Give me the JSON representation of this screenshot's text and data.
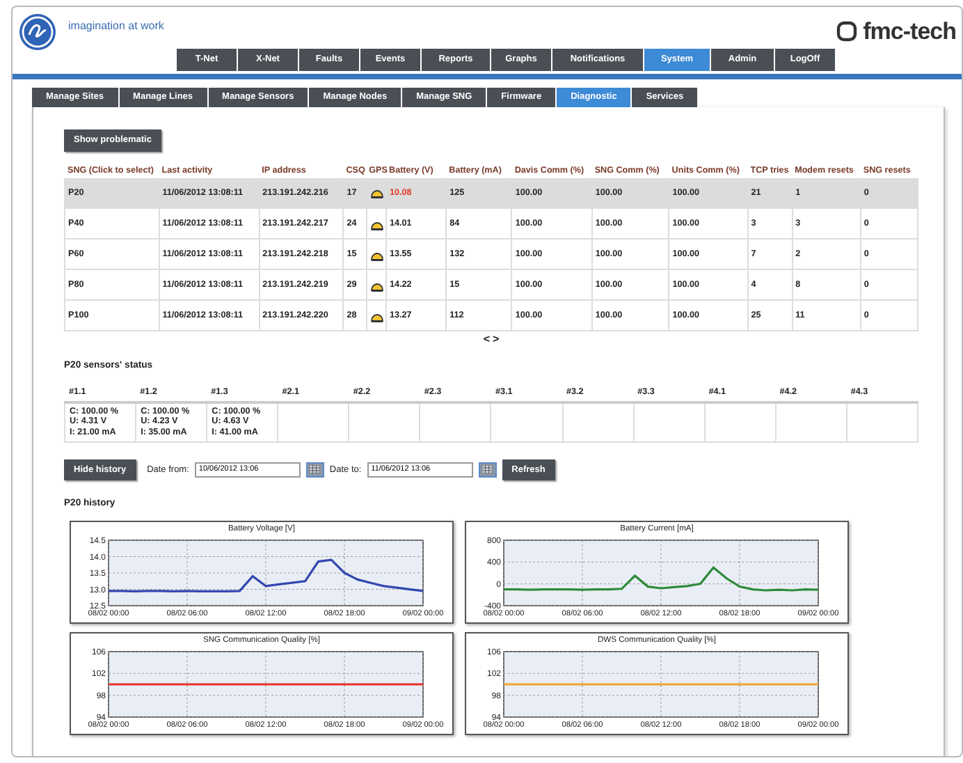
{
  "header": {
    "tagline": "imagination at work",
    "brand": "fmc-tech"
  },
  "main_tabs": [
    {
      "label": "T-Net",
      "selected": false
    },
    {
      "label": "X-Net",
      "selected": false
    },
    {
      "label": "Faults",
      "selected": false
    },
    {
      "label": "Events",
      "selected": false
    },
    {
      "label": "Reports",
      "selected": false
    },
    {
      "label": "Graphs",
      "selected": false
    },
    {
      "label": "Notifications",
      "selected": false
    },
    {
      "label": "System",
      "selected": true
    },
    {
      "label": "Admin",
      "selected": false
    },
    {
      "label": "LogOff",
      "selected": false
    }
  ],
  "sub_tabs": [
    {
      "label": "Manage Sites",
      "selected": false
    },
    {
      "label": "Manage Lines",
      "selected": false
    },
    {
      "label": "Manage Sensors",
      "selected": false
    },
    {
      "label": "Manage Nodes",
      "selected": false
    },
    {
      "label": "Manage SNG",
      "selected": false
    },
    {
      "label": "Firmware",
      "selected": false
    },
    {
      "label": "Diagnostic",
      "selected": true
    },
    {
      "label": "Services",
      "selected": false
    }
  ],
  "show_button": "Show problematic",
  "sng_table": {
    "columns": [
      "SNG (Click to select)",
      "Last activity",
      "IP address",
      "CSQ",
      "GPS",
      "Battery (V)",
      "Battery (mA)",
      "Davis Comm (%)",
      "SNG Comm (%)",
      "Units Comm (%)",
      "TCP tries",
      "Modem resets",
      "SNG resets"
    ],
    "rows": [
      {
        "selected": true,
        "gps_fix": true,
        "battery_alarm": true,
        "sng": "P20",
        "last_activity": "11/06/2012 13:08:11",
        "ip": "213.191.242.216",
        "csq": "17",
        "battery_v": "10.08",
        "battery_ma": "125",
        "davis": "100.00",
        "sng_comm": "100.00",
        "units": "100.00",
        "tcp": "21",
        "modem": "1",
        "sng_resets": "0"
      },
      {
        "selected": false,
        "gps_fix": true,
        "battery_alarm": false,
        "sng": "P40",
        "last_activity": "11/06/2012 13:08:11",
        "ip": "213.191.242.217",
        "csq": "24",
        "battery_v": "14.01",
        "battery_ma": "84",
        "davis": "100.00",
        "sng_comm": "100.00",
        "units": "100.00",
        "tcp": "3",
        "modem": "3",
        "sng_resets": "0"
      },
      {
        "selected": false,
        "gps_fix": true,
        "battery_alarm": false,
        "sng": "P60",
        "last_activity": "11/06/2012 13:08:11",
        "ip": "213.191.242.218",
        "csq": "15",
        "battery_v": "13.55",
        "battery_ma": "132",
        "davis": "100.00",
        "sng_comm": "100.00",
        "units": "100.00",
        "tcp": "7",
        "modem": "2",
        "sng_resets": "0"
      },
      {
        "selected": false,
        "gps_fix": true,
        "battery_alarm": false,
        "sng": "P80",
        "last_activity": "11/06/2012 13:08:11",
        "ip": "213.191.242.219",
        "csq": "29",
        "battery_v": "14.22",
        "battery_ma": "15",
        "davis": "100.00",
        "sng_comm": "100.00",
        "units": "100.00",
        "tcp": "4",
        "modem": "8",
        "sng_resets": "0"
      },
      {
        "selected": false,
        "gps_fix": true,
        "battery_alarm": false,
        "sng": "P100",
        "last_activity": "11/06/2012 13:08:11",
        "ip": "213.191.242.220",
        "csq": "28",
        "battery_v": "13.27",
        "battery_ma": "112",
        "davis": "100.00",
        "sng_comm": "100.00",
        "units": "100.00",
        "tcp": "25",
        "modem": "11",
        "sng_resets": "0"
      }
    ]
  },
  "pager": {
    "prev": "<",
    "next": ">"
  },
  "sensors": {
    "title": "P20 sensors' status",
    "columns": [
      "#1.1",
      "#1.2",
      "#1.3",
      "#2.1",
      "#2.2",
      "#2.3",
      "#3.1",
      "#3.2",
      "#3.3",
      "#4.1",
      "#4.2",
      "#4.3"
    ],
    "cells": [
      [
        "C: 100.00 %",
        "U: 4.31 V",
        "I: 21.00 mA"
      ],
      [
        "C: 100.00 %",
        "U: 4.23 V",
        "I: 35.00 mA"
      ],
      [
        "C: 100.00 %",
        "U: 4.63 V",
        "I: 41.00 mA"
      ],
      [],
      [],
      [],
      [],
      [],
      [],
      [],
      [],
      []
    ]
  },
  "history_controls": {
    "hide_button": "Hide history",
    "from_label": "Date from:",
    "from_value": "10/06/2012 13:06",
    "to_label": "Date to:",
    "to_value": "11/06/2012 13:06",
    "refresh_button": "Refresh"
  },
  "history": {
    "title": "P20 history",
    "charts": [
      {
        "chart_data": {
          "type": "line",
          "title": "Battery Voltage [V]",
          "grid": true,
          "categories": [
            "08/02 00:00",
            null,
            null,
            null,
            null,
            null,
            "08/02 06:00",
            null,
            null,
            null,
            null,
            null,
            "08/02 12:00",
            null,
            null,
            null,
            null,
            null,
            "08/02 18:00",
            null,
            null,
            null,
            null,
            null,
            "09/02 00:00"
          ],
          "ylim": [
            12.5,
            14.5
          ],
          "yticks": [
            {
              "value": 12.5,
              "label": "12.5"
            },
            {
              "value": 13,
              "label": "13.0"
            },
            {
              "value": 13.5,
              "label": "13.5"
            },
            {
              "value": 14,
              "label": "14.0"
            },
            {
              "value": 14.5,
              "label": "14.5"
            }
          ],
          "series": [
            {
              "color": "#3347b0",
              "values": [
                12.95,
                12.95,
                12.94,
                12.95,
                12.95,
                12.94,
                12.95,
                12.94,
                12.94,
                12.94,
                12.95,
                13.4,
                13.1,
                13.15,
                13.2,
                13.25,
                13.85,
                13.9,
                13.5,
                13.3,
                13.2,
                13.1,
                13.05,
                13.0,
                12.95
              ]
            }
          ]
        }
      },
      {
        "chart_data": {
          "type": "line",
          "title": "Battery Current [mA]",
          "grid": true,
          "categories": [
            "08/02 00:00",
            null,
            null,
            null,
            null,
            null,
            "08/02 06:00",
            null,
            null,
            null,
            null,
            null,
            "08/02 12:00",
            null,
            null,
            null,
            null,
            null,
            "08/02 18:00",
            null,
            null,
            null,
            null,
            null,
            "09/02 00:00"
          ],
          "ylim": [
            -400,
            800
          ],
          "yticks": [
            -400,
            0,
            400,
            800
          ],
          "series": [
            {
              "color": "#2e8b3a",
              "values": [
                -100,
                -100,
                -110,
                -100,
                -100,
                -100,
                -110,
                -100,
                -100,
                -90,
                150,
                -50,
                -80,
                -60,
                -40,
                0,
                300,
                100,
                -50,
                -100,
                -120,
                -110,
                -120,
                -100,
                -110
              ]
            }
          ]
        }
      },
      {
        "chart_data": {
          "type": "line",
          "title": "SNG Communication Quality [%]",
          "grid": true,
          "categories": [
            "08/02 00:00",
            null,
            null,
            null,
            null,
            null,
            "08/02 06:00",
            null,
            null,
            null,
            null,
            null,
            "08/02 12:00",
            null,
            null,
            null,
            null,
            null,
            "08/02 18:00",
            null,
            null,
            null,
            null,
            null,
            "09/02 00:00"
          ],
          "ylim": [
            94,
            106
          ],
          "yticks": [
            94,
            98,
            102,
            106
          ],
          "series": [
            {
              "color": "#e8302a",
              "values": [
                100,
                100,
                100,
                100,
                100,
                100,
                100,
                100,
                100,
                100,
                100,
                100,
                100,
                100,
                100,
                100,
                100,
                100,
                100,
                100,
                100,
                100,
                100,
                100,
                100
              ]
            }
          ]
        }
      },
      {
        "chart_data": {
          "type": "line",
          "title": "DWS Communication Quality [%]",
          "grid": true,
          "categories": [
            "08/02 00:00",
            null,
            null,
            null,
            null,
            null,
            "08/02 06:00",
            null,
            null,
            null,
            null,
            null,
            "08/02 12:00",
            null,
            null,
            null,
            null,
            null,
            "08/02 18:00",
            null,
            null,
            null,
            null,
            null,
            "09/02 00:00"
          ],
          "ylim": [
            94,
            106
          ],
          "yticks": [
            94,
            98,
            102,
            106
          ],
          "series": [
            {
              "color": "#f2a22a",
              "values": [
                100,
                100,
                100,
                100,
                100,
                100,
                100,
                100,
                100,
                100,
                100,
                100,
                100,
                100,
                100,
                100,
                100,
                100,
                100,
                100,
                100,
                100,
                100,
                100,
                100
              ]
            }
          ]
        }
      }
    ]
  }
}
